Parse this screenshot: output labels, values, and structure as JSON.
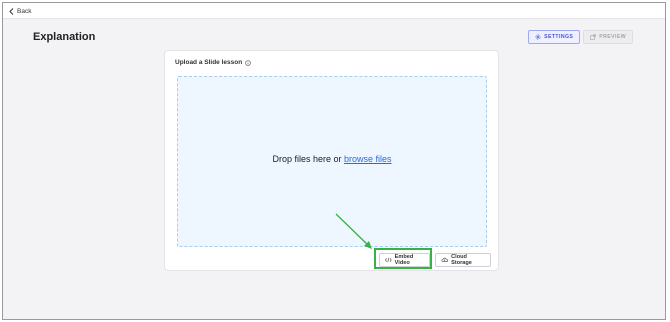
{
  "topbar": {
    "back_label": "Back"
  },
  "page": {
    "title": "Explanation"
  },
  "tabs": [
    {
      "label": "SETTINGS",
      "icon": "gear-icon",
      "active": true
    },
    {
      "label": "PREVIEW",
      "icon": "external-link-icon",
      "active": false
    }
  ],
  "upload": {
    "title": "Upload a Slide lesson",
    "drop_text": "Drop files here or",
    "browse_label": "browse files"
  },
  "buttons": {
    "embed_label": "Embed Video",
    "cloud_label": "Cloud Storage"
  },
  "colors": {
    "accent": "#4a56d8",
    "dropzone_bg": "#eef6ff",
    "link": "#2a6ad9",
    "highlight": "#36b347"
  }
}
